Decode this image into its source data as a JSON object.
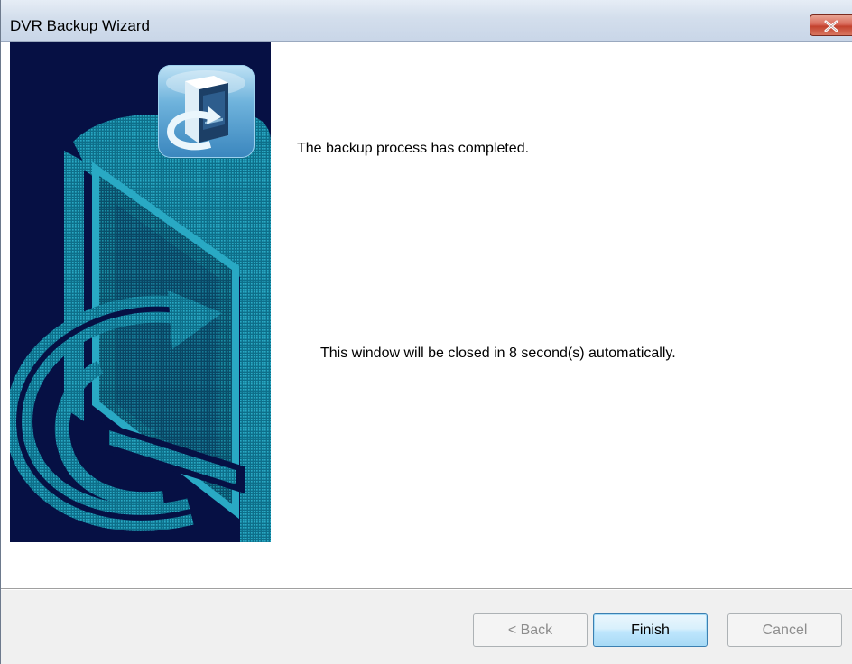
{
  "window": {
    "title": "DVR Backup Wizard",
    "close_icon": "close-icon"
  },
  "side_panel": {
    "app_icon": "computer-backup-icon",
    "background_color": "#061044",
    "art_color": "#1a8fa6"
  },
  "content": {
    "status_message": "The backup process has completed.",
    "auto_close_message": "This window will be closed in 8 second(s) automatically."
  },
  "buttons": {
    "back_label": "< Back",
    "finish_label": "Finish",
    "cancel_label": "Cancel"
  }
}
